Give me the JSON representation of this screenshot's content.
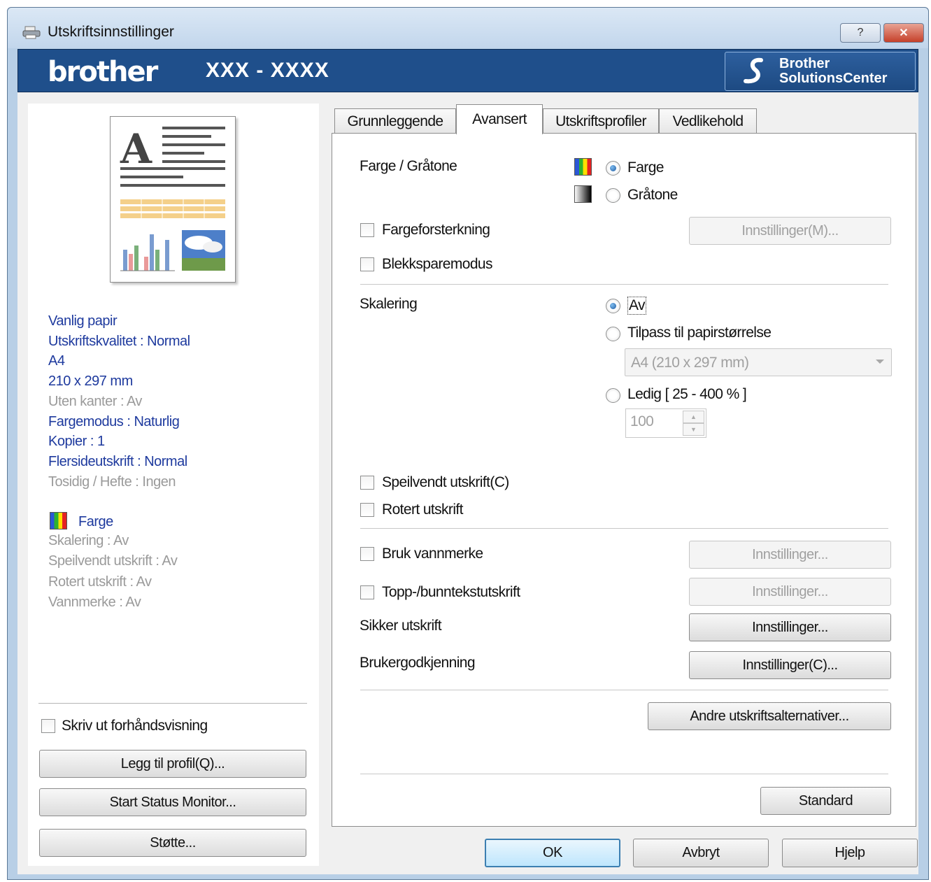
{
  "window": {
    "title": "Utskriftsinnstillinger",
    "help_caption": "?",
    "close_caption": "✕"
  },
  "brand": {
    "logo": "brother",
    "model": "XXX - XXXX",
    "solutions_line1": "Brother",
    "solutions_line2": "SolutionsCenter"
  },
  "tabs": [
    {
      "label": "Grunnleggende",
      "active": false
    },
    {
      "label": "Avansert",
      "active": true
    },
    {
      "label": "Utskriftsprofiler",
      "active": false
    },
    {
      "label": "Vedlikehold",
      "active": false
    }
  ],
  "summary": {
    "lines": [
      {
        "text": "Vanlig papir",
        "enabled": true
      },
      {
        "text": "Utskriftskvalitet : Normal",
        "enabled": true
      },
      {
        "text": "A4",
        "enabled": true
      },
      {
        "text": "210 x 297 mm",
        "enabled": true
      },
      {
        "text": "Uten kanter : Av",
        "enabled": false
      },
      {
        "text": "Fargemodus : Naturlig",
        "enabled": true
      },
      {
        "text": "Kopier : 1",
        "enabled": true
      },
      {
        "text": "Flersideutskrift : Normal",
        "enabled": true
      },
      {
        "text": "Tosidig / Hefte : Ingen",
        "enabled": false
      }
    ],
    "color_label": "Farge",
    "lines2": [
      {
        "text": "Skalering : Av",
        "enabled": false
      },
      {
        "text": "Speilvendt utskrift : Av",
        "enabled": false
      },
      {
        "text": "Rotert utskrift : Av",
        "enabled": false
      },
      {
        "text": "Vannmerke : Av",
        "enabled": false
      }
    ]
  },
  "left_controls": {
    "preview_checkbox": "Skriv ut forhåndsvisning",
    "preview_checked": false,
    "add_profile": "Legg til profil(Q)...",
    "status_monitor": "Start Status Monitor...",
    "support": "Støtte..."
  },
  "advanced": {
    "color_label": "Farge / Gråtone",
    "color_option": "Farge",
    "gray_option": "Gråtone",
    "color_selected": "Farge",
    "enhancement_label": "Fargeforsterkning",
    "enhancement_checked": false,
    "enhancement_settings": "Innstillinger(M)...",
    "inksave_label": "Blekksparemodus",
    "inksave_checked": false,
    "scaling_label": "Skalering",
    "scaling_off": "Av",
    "scaling_fit": "Tilpass til papirstørrelse",
    "scaling_fit_value": "A4 (210 x 297 mm)",
    "scaling_free": "Ledig [ 25 - 400 % ]",
    "scaling_free_value": "100",
    "scaling_selected": "Av",
    "mirror_label": "Speilvendt utskrift(C)",
    "mirror_checked": false,
    "rotate_label": "Rotert utskrift",
    "rotate_checked": false,
    "watermark_label": "Bruk vannmerke",
    "watermark_checked": false,
    "watermark_settings": "Innstillinger...",
    "header_footer_label": "Topp-/bunntekstutskrift",
    "header_footer_checked": false,
    "header_footer_settings": "Innstillinger...",
    "secure_label": "Sikker utskrift",
    "secure_settings": "Innstillinger...",
    "auth_label": "Brukergodkjenning",
    "auth_settings": "Innstillinger(C)...",
    "other_options": "Andre utskriftsalternativer...",
    "default_button": "Standard"
  },
  "footer": {
    "ok": "OK",
    "cancel": "Avbryt",
    "help": "Hjelp"
  },
  "colors": {
    "brand_bar": "#1f4f8b",
    "summary_text": "#1e3a9e",
    "disabled_text": "#9a9a9a"
  }
}
